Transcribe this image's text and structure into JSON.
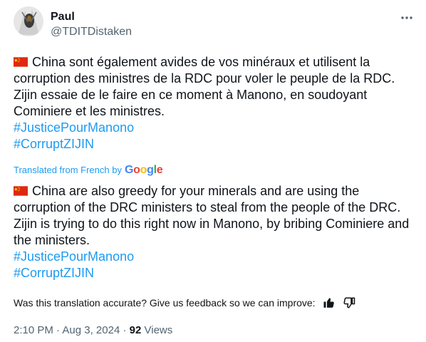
{
  "author": {
    "name": "Paul",
    "handle": "@TDITDistaken"
  },
  "icons": {
    "more": "more-horizontal-icon",
    "flag": "china-flag-icon",
    "thumbs_up": "thumbs-up-icon",
    "thumbs_down": "thumbs-down-icon"
  },
  "original_text": {
    "body": "China sont également avides de vos minéraux et utilisent la corruption des ministres de la RDC pour voler le peuple de la RDC. Zijin essaie de le faire en ce moment à Manono, en soudoyant Cominiere et les ministres.",
    "hashtags": [
      "#JusticePourManono",
      "#CorruptZIJIN"
    ]
  },
  "translation": {
    "notice": "Translated from French by",
    "provider": "Google",
    "body": "China are also greedy for your minerals and are using the corruption of the DRC ministers to steal from the people of the DRC. Zijin is trying to do this right now in Manono, by bribing Cominiere and the ministers.",
    "hashtags": [
      "#JusticePourManono",
      "#CorruptZIJIN"
    ]
  },
  "feedback": {
    "question": "Was this translation accurate? Give us feedback so we can improve:"
  },
  "meta": {
    "time": "2:10 PM",
    "separator": "·",
    "date": "Aug 3, 2024",
    "views_count": "92",
    "views_label": "Views"
  },
  "colors": {
    "link": "#1d9bf0",
    "text": "#0f1419",
    "muted": "#536471",
    "flag_red": "#de2910",
    "flag_yellow": "#ffde00"
  }
}
